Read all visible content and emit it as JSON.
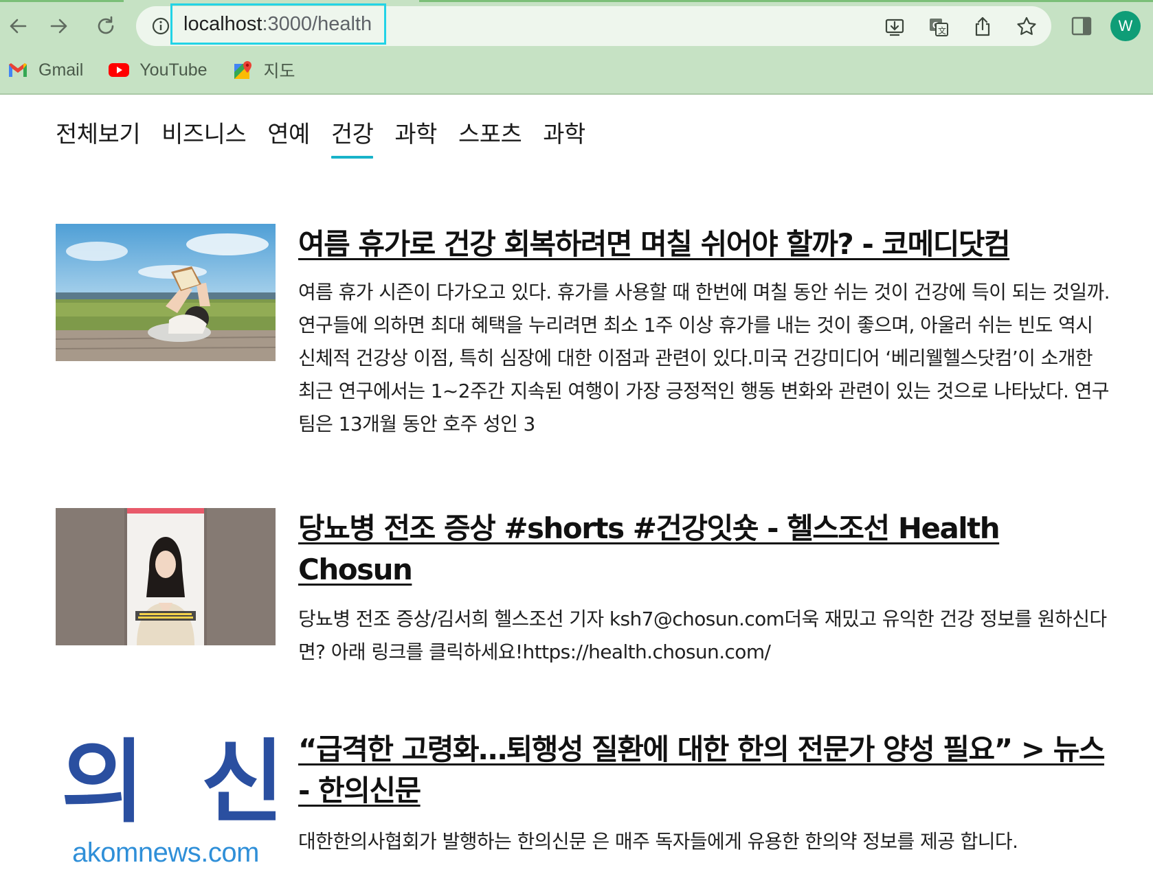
{
  "browser": {
    "url_host": "localhost",
    "url_path": ":3000/health",
    "profile_initial": "W",
    "bookmarks": [
      {
        "label": "Gmail",
        "icon": "gmail-icon"
      },
      {
        "label": "YouTube",
        "icon": "youtube-icon"
      },
      {
        "label": "지도",
        "icon": "maps-icon"
      }
    ]
  },
  "colors": {
    "chrome_bg": "#c6e2c4",
    "active_tab_underline": "#18b3c9",
    "url_highlight": "#22d3e6",
    "avatar": "#0f9d77"
  },
  "categories": [
    {
      "label": "전체보기",
      "active": false
    },
    {
      "label": "비즈니스",
      "active": false
    },
    {
      "label": "연예",
      "active": false
    },
    {
      "label": "건강",
      "active": true
    },
    {
      "label": "과학",
      "active": false
    },
    {
      "label": "스포츠",
      "active": false
    },
    {
      "label": "과학",
      "active": false
    }
  ],
  "articles": [
    {
      "title": "여름 휴가로 건강 회복하려면 며칠 쉬어야 할까? - 코메디닷컴",
      "description": "여름 휴가 시즌이 다가오고 있다. 휴가를 사용할 때 한번에 며칠 동안 쉬는 것이 건강에 득이 되는 것일까. 연구들에 의하면 최대 혜택을 누리려면 최소 1주 이상 휴가를 내는 것이 좋으며, 아울러 쉬는 빈도 역시 신체적 건강상 이점, 특히 심장에 대한 이점과 관련이 있다.미국 건강미디어 ‘베리웰헬스닷컴’이 소개한 최근 연구에서는 1~2주간 지속된 여행이 가장 긍정적인 행동 변화와 관련이 있는 것으로 나타났다. 연구팀은 13개월 동안 호주 성인 3",
      "thumbnail": "photo-person-reading-outdoors"
    },
    {
      "title": "당뇨병 전조 증상 #shorts #건강잇숏 - 헬스조선 Health Chosun",
      "description": "당뇨병 전조 증상/김서희 헬스조선 기자 ksh7@chosun.com더욱 재밌고 유익한 건강 정보를 원하신다면? 아래 링크를 클릭하세요!https://health.chosun.com/",
      "thumbnail": "video-still-reporter"
    },
    {
      "title": "“급격한 고령화…퇴행성 질환에 대한 한의 전문가 양성 필요” > 뉴스 - 한의신문",
      "description": "대한한의사협회가 발행하는 한의신문 은 매주 독자들에게 유용한 한의약 정보를 제공 합니다.",
      "thumbnail": "akomnews-logo",
      "logo_text": "의 신",
      "logo_domain": "akomnews.com"
    }
  ]
}
